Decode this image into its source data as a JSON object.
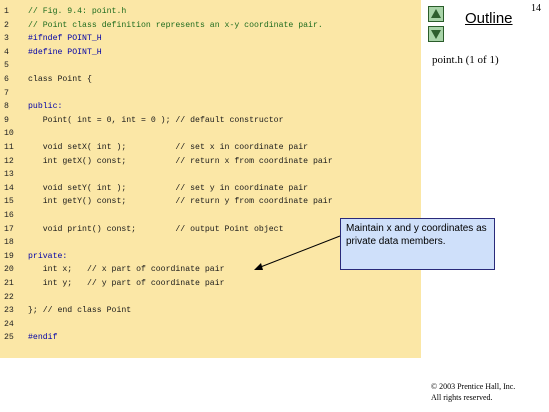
{
  "page_number": "14",
  "outline": {
    "title": "Outline",
    "file_caption": "point.h (1 of 1)",
    "up_button_icon": "triangle-up-icon",
    "down_button_icon": "triangle-down-icon"
  },
  "code_lines": [
    {
      "num": "1",
      "text": "// Fig. 9.4: point.h",
      "style": "cm"
    },
    {
      "num": "2",
      "text": "// Point class definition represents an x-y coordinate pair.",
      "style": "cm"
    },
    {
      "num": "3",
      "text": "#ifndef POINT_H",
      "style": "kw"
    },
    {
      "num": "4",
      "text": "#define POINT_H",
      "style": "kw"
    },
    {
      "num": "5",
      "text": "",
      "style": ""
    },
    {
      "num": "6",
      "text": "class Point {",
      "style": ""
    },
    {
      "num": "7",
      "text": "",
      "style": ""
    },
    {
      "num": "8",
      "text": "public:",
      "style": "kw"
    },
    {
      "num": "9",
      "text": "   Point( int = 0, int = 0 ); // default constructor",
      "style": ""
    },
    {
      "num": "10",
      "text": "",
      "style": ""
    },
    {
      "num": "11",
      "text": "   void setX( int );          // set x in coordinate pair",
      "style": ""
    },
    {
      "num": "12",
      "text": "   int getX() const;          // return x from coordinate pair",
      "style": ""
    },
    {
      "num": "13",
      "text": "",
      "style": ""
    },
    {
      "num": "14",
      "text": "   void setY( int );          // set y in coordinate pair",
      "style": ""
    },
    {
      "num": "15",
      "text": "   int getY() const;          // return y from coordinate pair",
      "style": ""
    },
    {
      "num": "16",
      "text": "",
      "style": ""
    },
    {
      "num": "17",
      "text": "   void print() const;        // output Point object",
      "style": ""
    },
    {
      "num": "18",
      "text": "",
      "style": ""
    },
    {
      "num": "19",
      "text": "private:",
      "style": "kw"
    },
    {
      "num": "20",
      "text": "   int x;   // x part of coordinate pair",
      "style": ""
    },
    {
      "num": "21",
      "text": "   int y;   // y part of coordinate pair",
      "style": ""
    },
    {
      "num": "22",
      "text": "",
      "style": ""
    },
    {
      "num": "23",
      "text": "}; // end class Point",
      "style": ""
    },
    {
      "num": "24",
      "text": "",
      "style": ""
    },
    {
      "num": "25",
      "text": "#endif",
      "style": "kw"
    }
  ],
  "callout": {
    "text": "Maintain x and y coordinates as private data members."
  },
  "copyright": {
    "line1": "© 2003 Prentice Hall, Inc.",
    "line2": "All rights reserved."
  },
  "colors": {
    "code_background": "#fbe7a6",
    "callout_background": "#cfe0fa",
    "nav_button": "#a9d4a9"
  }
}
